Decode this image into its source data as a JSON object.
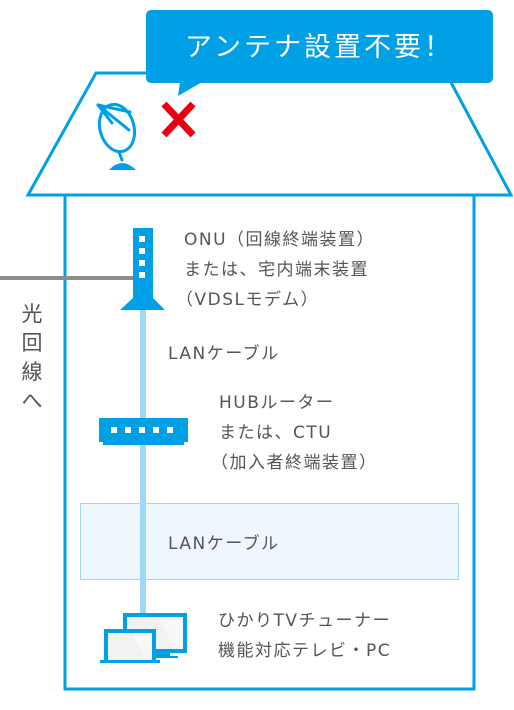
{
  "colors": {
    "primary": "#00a0e6",
    "cable": "#9fd9f5",
    "fiber_line": "#8c8c8c",
    "cross": "#e60012",
    "highlight_bg": "#eef7fd",
    "text": "#555555"
  },
  "callout": {
    "text": "アンテナ設置不要！"
  },
  "icons": {
    "antenna": "satellite-dish-icon",
    "cross": "cross-mark-icon",
    "onu": "onu-tower-icon",
    "hub": "hub-router-icon",
    "devices": "tv-pc-icon"
  },
  "side_label": {
    "chars": [
      "光",
      "回",
      "線",
      "へ"
    ]
  },
  "onu": {
    "lines": [
      "ONU（回線終端装置）",
      "または、宅内端末装置",
      "（VDSLモデム）"
    ]
  },
  "cable1": {
    "label": "LANケーブル"
  },
  "hub": {
    "lines": [
      "HUBルーター",
      "または、CTU",
      "（加入者終端装置）"
    ]
  },
  "cable2": {
    "label": "LANケーブル"
  },
  "devices": {
    "lines": [
      "ひかりTVチューナー",
      "機能対応テレビ・PC"
    ]
  }
}
